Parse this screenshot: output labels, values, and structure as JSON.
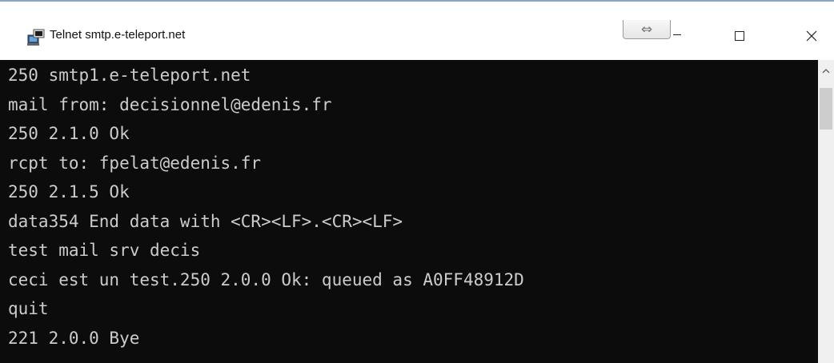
{
  "window": {
    "title": "Telnet smtp.e-teleport.net",
    "resize_glyph": "⇔"
  },
  "console": {
    "lines": [
      "250 smtp1.e-teleport.net",
      "mail from: decisionnel@edenis.fr",
      "250 2.1.0 Ok",
      "rcpt to: fpelat@edenis.fr",
      "250 2.1.5 Ok",
      "data354 End data with <CR><LF>.<CR><LF>",
      "test mail srv decis",
      "ceci est un test.250 2.0.0 Ok: queued as A0FF48912D",
      "quit",
      "221 2.0.0 Bye"
    ]
  },
  "colors": {
    "console_bg": "#0c0c0c",
    "console_text": "#cccccc",
    "titlebar_bg": "#ffffff"
  },
  "icons": {
    "app": "telnet-console-icon",
    "resize": "resize-horizontal-icon",
    "minimize": "minimize-icon",
    "maximize": "maximize-icon",
    "close": "close-icon",
    "scroll_up": "chevron-up-icon"
  }
}
